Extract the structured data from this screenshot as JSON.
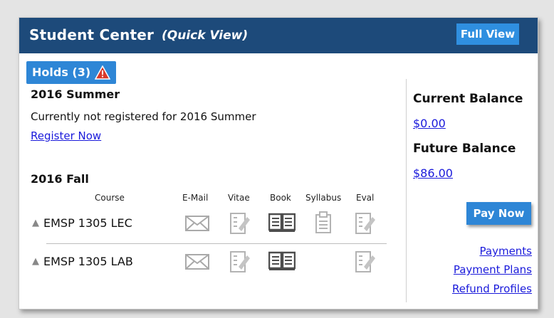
{
  "header": {
    "title": "Student Center",
    "subtitle": "(Quick View)",
    "full_view_label": "Full View"
  },
  "holds": {
    "label": "Holds (3)"
  },
  "summer": {
    "term": "2016 Summer",
    "message": "Currently not registered for 2016 Summer",
    "register_link": "Register Now"
  },
  "fall": {
    "term": "2016 Fall",
    "columns": [
      "Course",
      "E-Mail",
      "Vitae",
      "Book",
      "Syllabus",
      "Eval"
    ],
    "courses": [
      {
        "name": "EMSP 1305 LEC",
        "icons": [
          "email-icon",
          "vitae-icon",
          "book-icon",
          "syllabus-icon",
          "eval-icon"
        ]
      },
      {
        "name": "EMSP 1305 LAB",
        "icons": [
          "email-icon",
          "vitae-icon",
          "book-icon",
          "eval-icon"
        ]
      }
    ]
  },
  "balance": {
    "current_label": "Current Balance",
    "current_value": "$0.00",
    "future_label": "Future Balance",
    "future_value": "$86.00",
    "pay_now_label": "Pay Now"
  },
  "links": {
    "payments": "Payments",
    "payment_plans": "Payment Plans",
    "refund_profiles": "Refund Profiles"
  },
  "colors": {
    "header_bg": "#1d4a7a",
    "accent": "#2e86d6",
    "link": "#1a1adb",
    "warning": "#d93a2b"
  }
}
